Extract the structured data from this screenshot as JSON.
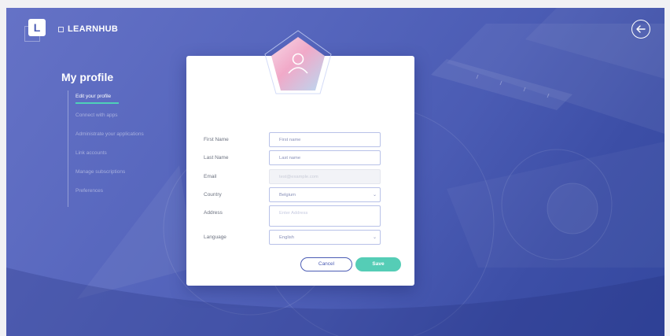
{
  "header": {
    "logo_letter": "L",
    "brand_name": "LEARNHUB",
    "back_icon": "arrow-left-icon"
  },
  "sidebar": {
    "title": "My profile",
    "items": [
      {
        "label": "Edit your profile",
        "active": true
      },
      {
        "label": "Connect with apps",
        "active": false
      },
      {
        "label": "Administrate your applications",
        "active": false
      },
      {
        "label": "Link accounts",
        "active": false
      },
      {
        "label": "Manage subscriptions",
        "active": false
      },
      {
        "label": "Preferences",
        "active": false
      }
    ]
  },
  "profile_form": {
    "avatar_icon": "user-icon",
    "first_name": {
      "label": "First Name",
      "value": "First name"
    },
    "last_name": {
      "label": "Last Name",
      "value": "Last name"
    },
    "email": {
      "label": "Email",
      "value": "test@example.com"
    },
    "country": {
      "label": "Country",
      "value": "Belgium"
    },
    "address": {
      "label": "Address",
      "placeholder": "Enter Address"
    },
    "language": {
      "label": "Language",
      "value": "English"
    },
    "cancel_label": "Cancel",
    "save_label": "Save"
  },
  "colors": {
    "accent": "#55cdb6",
    "primary": "#4b5cb4",
    "background_start": "#6572c6",
    "background_end": "#34489f"
  }
}
